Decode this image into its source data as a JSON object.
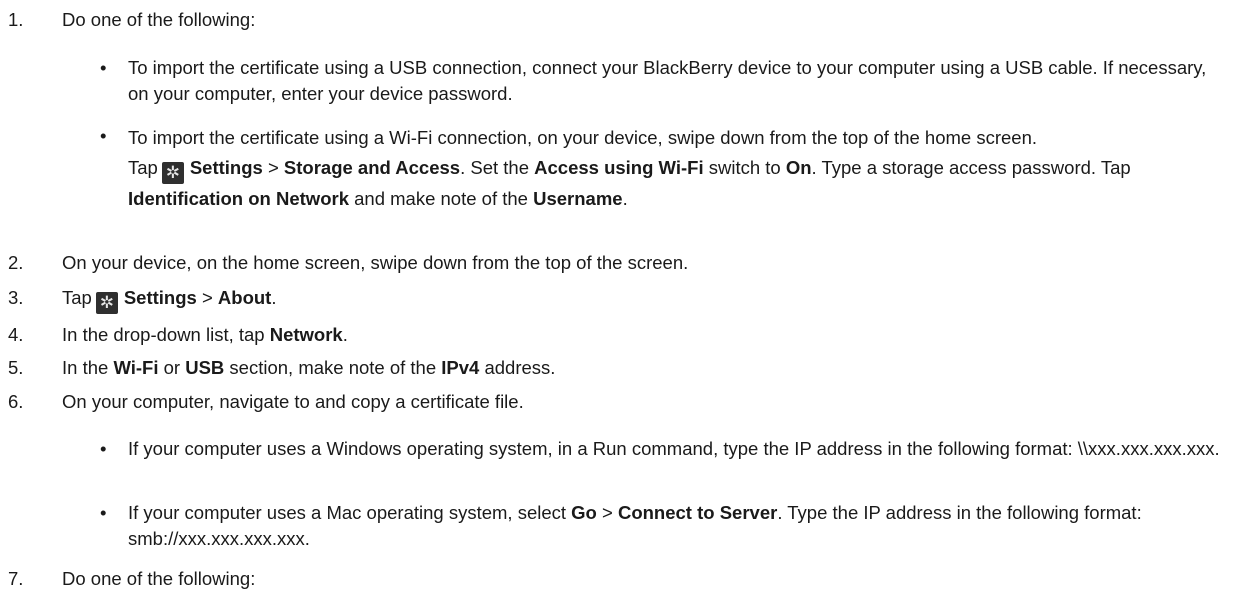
{
  "steps": {
    "s1": {
      "num": "1.",
      "text": "Do one of the following:"
    },
    "b1": {
      "bullet": "•",
      "text": "To import the certificate using a USB connection, connect your BlackBerry device to your computer using a USB cable. If necessary, on your computer, enter your device password."
    },
    "b2": {
      "bullet": "•",
      "line1": "To import the certificate using a Wi-Fi connection, on your device, swipe down from the top of the home screen.",
      "tap": "Tap",
      "settings": "Settings",
      "sep": ">",
      "storage": "Storage and Access",
      "set_the": ". Set the",
      "access": "Access using Wi-Fi",
      "switch_to": "switch to",
      "on": "On",
      "type_pw": ". Type a storage access password. Tap",
      "ident": "Identification on Network",
      "make_note": "and make note of the",
      "username": "Username",
      "end": "."
    },
    "s2": {
      "num": "2.",
      "text": "On your device, on the home screen, swipe down from the top of the screen."
    },
    "s3": {
      "num": "3.",
      "tap": "Tap",
      "settings": "Settings",
      "sep": ">",
      "about": "About",
      "end": "."
    },
    "s4": {
      "num": "4.",
      "text": "In the drop-down list, tap",
      "network": "Network",
      "end": "."
    },
    "s5": {
      "num": "5.",
      "pre": "In the",
      "wifi": "Wi-Fi",
      "or": "or",
      "usb": "USB",
      "mid": "section, make note of the",
      "ipv4": "IPv4",
      "post": "address."
    },
    "s6": {
      "num": "6.",
      "text": "On your computer, navigate to and copy a certificate file."
    },
    "b3": {
      "bullet": "•",
      "text": "If your computer uses a Windows operating system, in a Run command, type the IP address in the following format: \\\\xxx.xxx.xxx.xxx."
    },
    "b4": {
      "bullet": "•",
      "pre": "If your computer uses a Mac operating system, select",
      "go": "Go",
      "sep": ">",
      "connect": "Connect to Server",
      "post": ". Type the IP address in the following format: smb://xxx.xxx.xxx.xxx."
    },
    "s7": {
      "num": "7.",
      "text": "Do one of the following:"
    }
  },
  "icons": {
    "settings": "gear-icon"
  }
}
